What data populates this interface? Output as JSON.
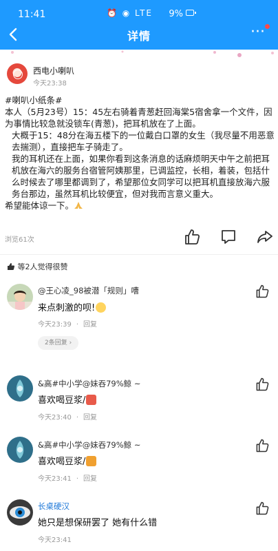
{
  "status_bar": {
    "time": "11:41",
    "icons": "⏰ ◉ LTE",
    "battery": "9%"
  },
  "header": {
    "title": "详情",
    "more_label": "···"
  },
  "post": {
    "author": "西电小喇叭",
    "time": "今天23:38",
    "hashtag": "#喇叭小纸条#",
    "paragraphs": [
      "本人（5月23号）15：45左右骑着青葱赶回海棠5宿舍拿一个文件，因为事情比较急就没锁车(青葱)，把耳机放在了上面。",
      "大概于15：48分在海五楼下的一位戴白口罩的女生（我尽量不用恶意去揣测），直接把车子骑走了。",
      "我的耳机还在上面，如果你看到这条消息的话麻烦明天中午之前把耳机放在海六的服务台宿管阿姨那里，已调监控，长相，着装，包括什么时候去了哪里都调到了，希望那位女同学可以把耳机直接放海六服务台那边，虽然耳机比较便宜，但对我而言意义重大。"
    ],
    "closing": "希望能体谅一下。",
    "views": "浏览61次"
  },
  "likes_summary": "等2人觉得很赞",
  "comments": [
    {
      "name": "@王心凌_98被潜「规则」嘈",
      "text": "来点刺激的呗!",
      "time": "今天23:39",
      "reply_label": "回复",
      "replies_label": "2条回复",
      "avatar": "photo"
    },
    {
      "name": "&高#中小学@妹吞79%鲸 ~",
      "text": "喜欢喝豆浆/",
      "time": "今天23:40",
      "reply_label": "回复",
      "avatar": "teal"
    },
    {
      "name": "&高#中小学@妹吞79%鲸 ~",
      "text": "喜欢喝豆浆/",
      "time": "今天23:41",
      "reply_label": "回复",
      "avatar": "teal"
    },
    {
      "name": "长桌硬汉",
      "text": "她只是想保研罢了 她有什么错",
      "time": "今天23:41",
      "avatar": "eye"
    }
  ],
  "colors": {
    "header_bg": "#1e9aff",
    "name_blue": "#1e78d8",
    "muted": "#999999"
  }
}
